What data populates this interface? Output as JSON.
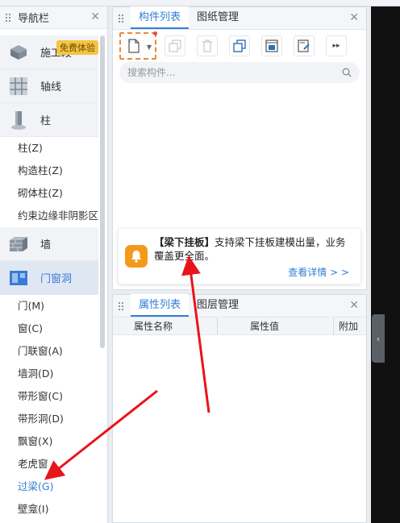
{
  "nav": {
    "title": "导航栏",
    "badge": "免费体验",
    "cats_top": [
      {
        "label": "施工段"
      },
      {
        "label": "轴线"
      },
      {
        "label": "柱"
      }
    ],
    "col_items": [
      "柱(Z)",
      "构造柱(Z)",
      "砌体柱(Z)",
      "约束边缘非阴影区..."
    ],
    "wall_cat": "墙",
    "door_cat": "门窗洞",
    "door_items": [
      "门(M)",
      "窗(C)",
      "门联窗(A)",
      "墙洞(D)",
      "带形窗(C)",
      "带形洞(D)",
      "飘窗(X)",
      "老虎窗",
      "过梁(G)",
      "壁龛(I)"
    ]
  },
  "comp": {
    "tabs": [
      "构件列表",
      "图纸管理"
    ],
    "search_placeholder": "搜索构件...",
    "promo": {
      "bold": "【梁下挂板】",
      "text": "支持梁下挂板建模出量，业务覆盖更全面。",
      "link": "查看详情 > >"
    }
  },
  "prop": {
    "tabs": [
      "属性列表",
      "图层管理"
    ],
    "columns": [
      "属性名称",
      "属性值",
      "附加"
    ]
  },
  "colors": {
    "accent": "#2f7fd7",
    "highlight": "#e68b3a",
    "arrow": "#e8141b"
  }
}
